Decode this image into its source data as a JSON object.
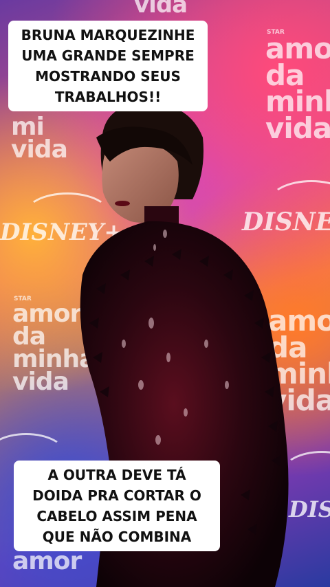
{
  "captions": {
    "top": "BRUNA MARQUEZINHE UMA GRANDE SEMPRE MOSTRANDO SEUS TRABALHOS!!",
    "bottom": "A OUTRA DEVE TÁ DOIDA PRA CORTAR O CABELO ASSIM PENA QUE NÃO COMBINA"
  },
  "backdrop": {
    "logo_text": "DISNEY+",
    "show_title": "amor\nda\nminha\nvida",
    "star_mark": "STAR",
    "partial_title_top": "vida",
    "partial_title_left": "mi\nvida",
    "partial_title_bottom": "amor"
  }
}
